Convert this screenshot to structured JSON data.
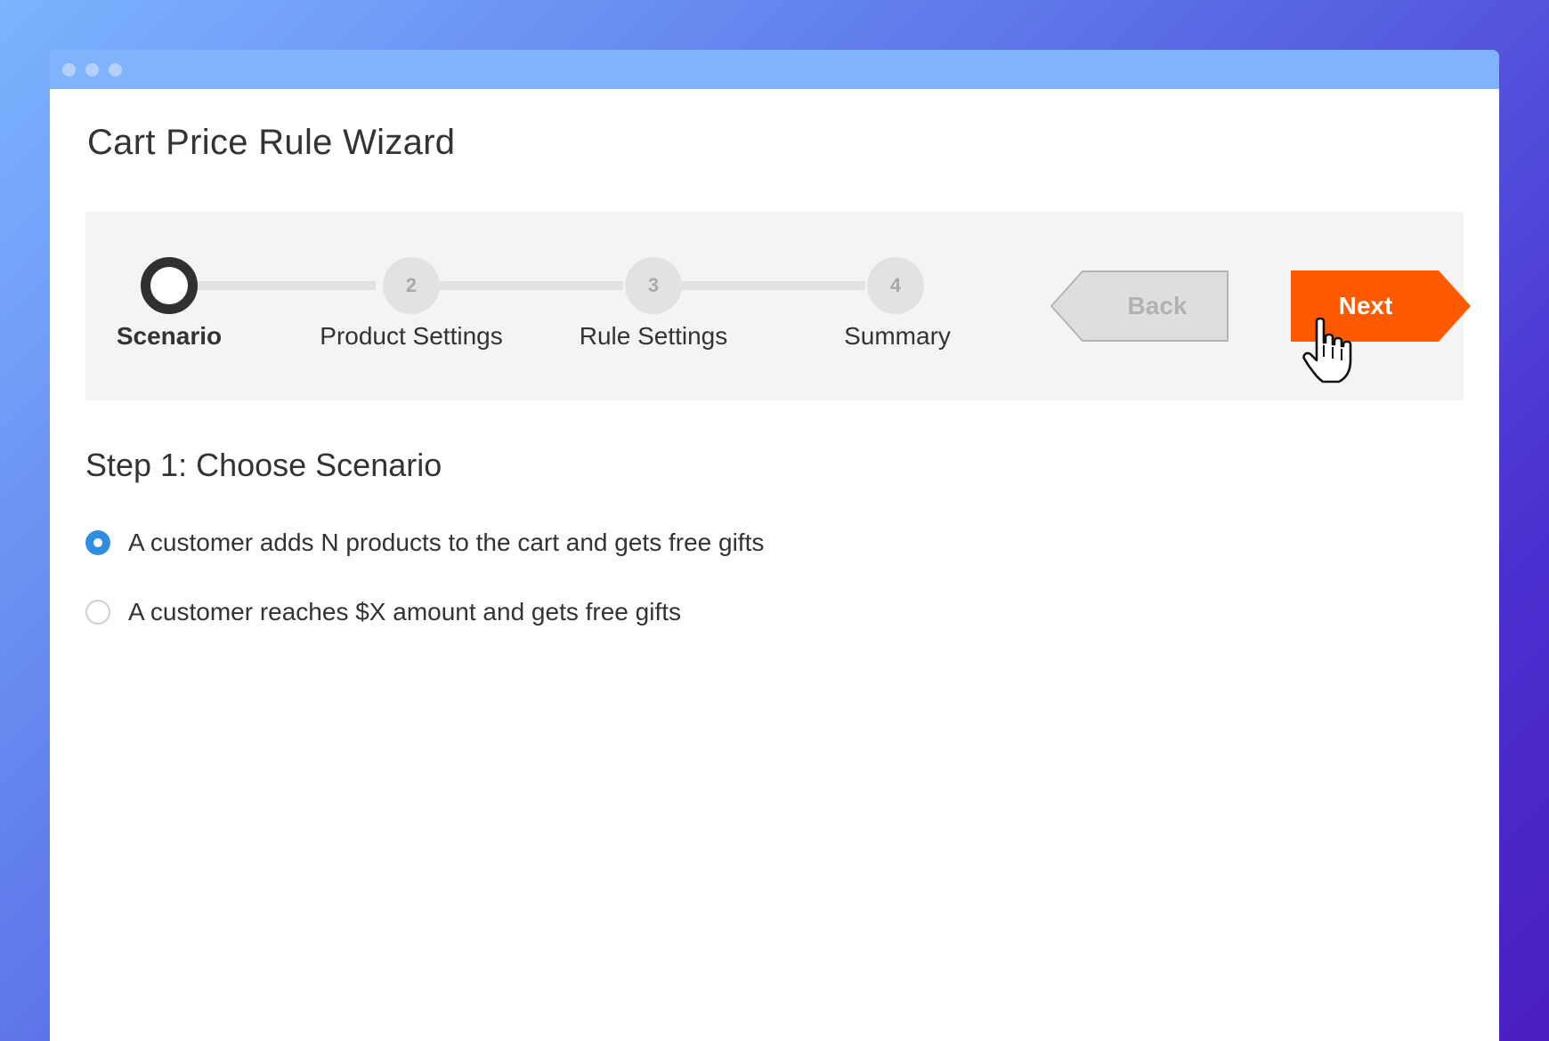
{
  "window": {
    "titlebar_dots": [
      "dot",
      "dot",
      "dot"
    ]
  },
  "page": {
    "title": "Cart Price Rule Wizard"
  },
  "wizard": {
    "current_step": 1,
    "steps": [
      {
        "number": "",
        "label": "Scenario",
        "state": "active"
      },
      {
        "number": "2",
        "label": "Product Settings",
        "state": "pending"
      },
      {
        "number": "3",
        "label": "Rule Settings",
        "state": "pending"
      },
      {
        "number": "4",
        "label": "Summary",
        "state": "pending"
      }
    ],
    "back_label": "Back",
    "next_label": "Next"
  },
  "step_content": {
    "heading": "Step 1: Choose Scenario",
    "options": [
      {
        "label": "A customer adds N products to the cart and gets free gifts",
        "selected": true
      },
      {
        "label": "A customer reaches $X amount and gets free gifts",
        "selected": false
      }
    ]
  },
  "icons": {
    "cursor": "hand-pointer-icon"
  },
  "colors": {
    "accent": "#ff5a00",
    "radio_checked": "#2f8de4",
    "titlebar": "#80b3fd",
    "step_active": "#303030",
    "step_inactive": "#e2e2e2"
  }
}
